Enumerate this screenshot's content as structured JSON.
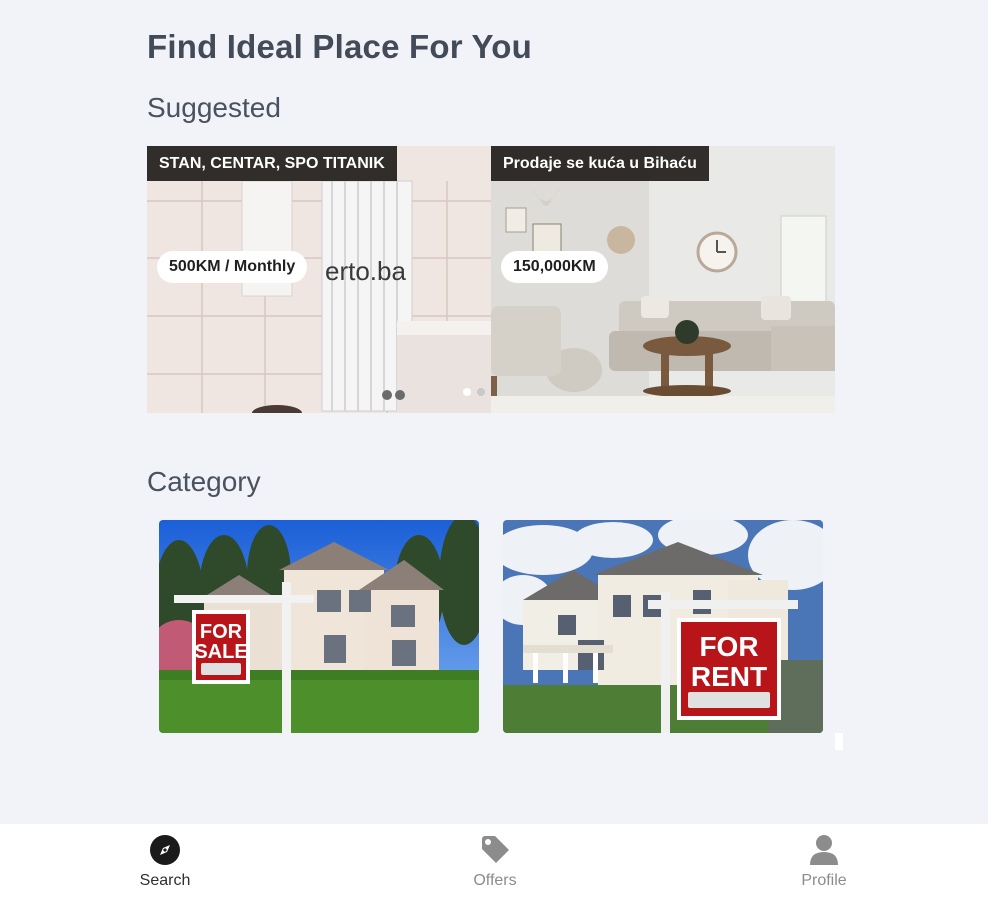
{
  "header": {
    "title": "Find Ideal Place For You"
  },
  "sections": {
    "suggested": "Suggested",
    "category": "Category"
  },
  "suggested": [
    {
      "title": "STAN, CENTAR, SPO TITANIK",
      "price": "500KM / Monthly",
      "watermark": "erto.ba"
    },
    {
      "title": "Prodaje se kuća u Bihaću",
      "price": "150,000KM"
    }
  ],
  "categories": [
    {
      "name": "for-sale",
      "sign_line1": "FOR",
      "sign_line2": "SALE"
    },
    {
      "name": "for-rent",
      "sign_line1": "FOR",
      "sign_line2": "RENT"
    }
  ],
  "nav": [
    {
      "label": "Search",
      "icon": "compass-icon",
      "active": true
    },
    {
      "label": "Offers",
      "icon": "tag-icon",
      "active": false
    },
    {
      "label": "Profile",
      "icon": "user-icon",
      "active": false
    }
  ],
  "colors": {
    "accent_dark": "#1a1a1a",
    "inactive": "#8c8c8c",
    "sign_red": "#b8151b"
  }
}
